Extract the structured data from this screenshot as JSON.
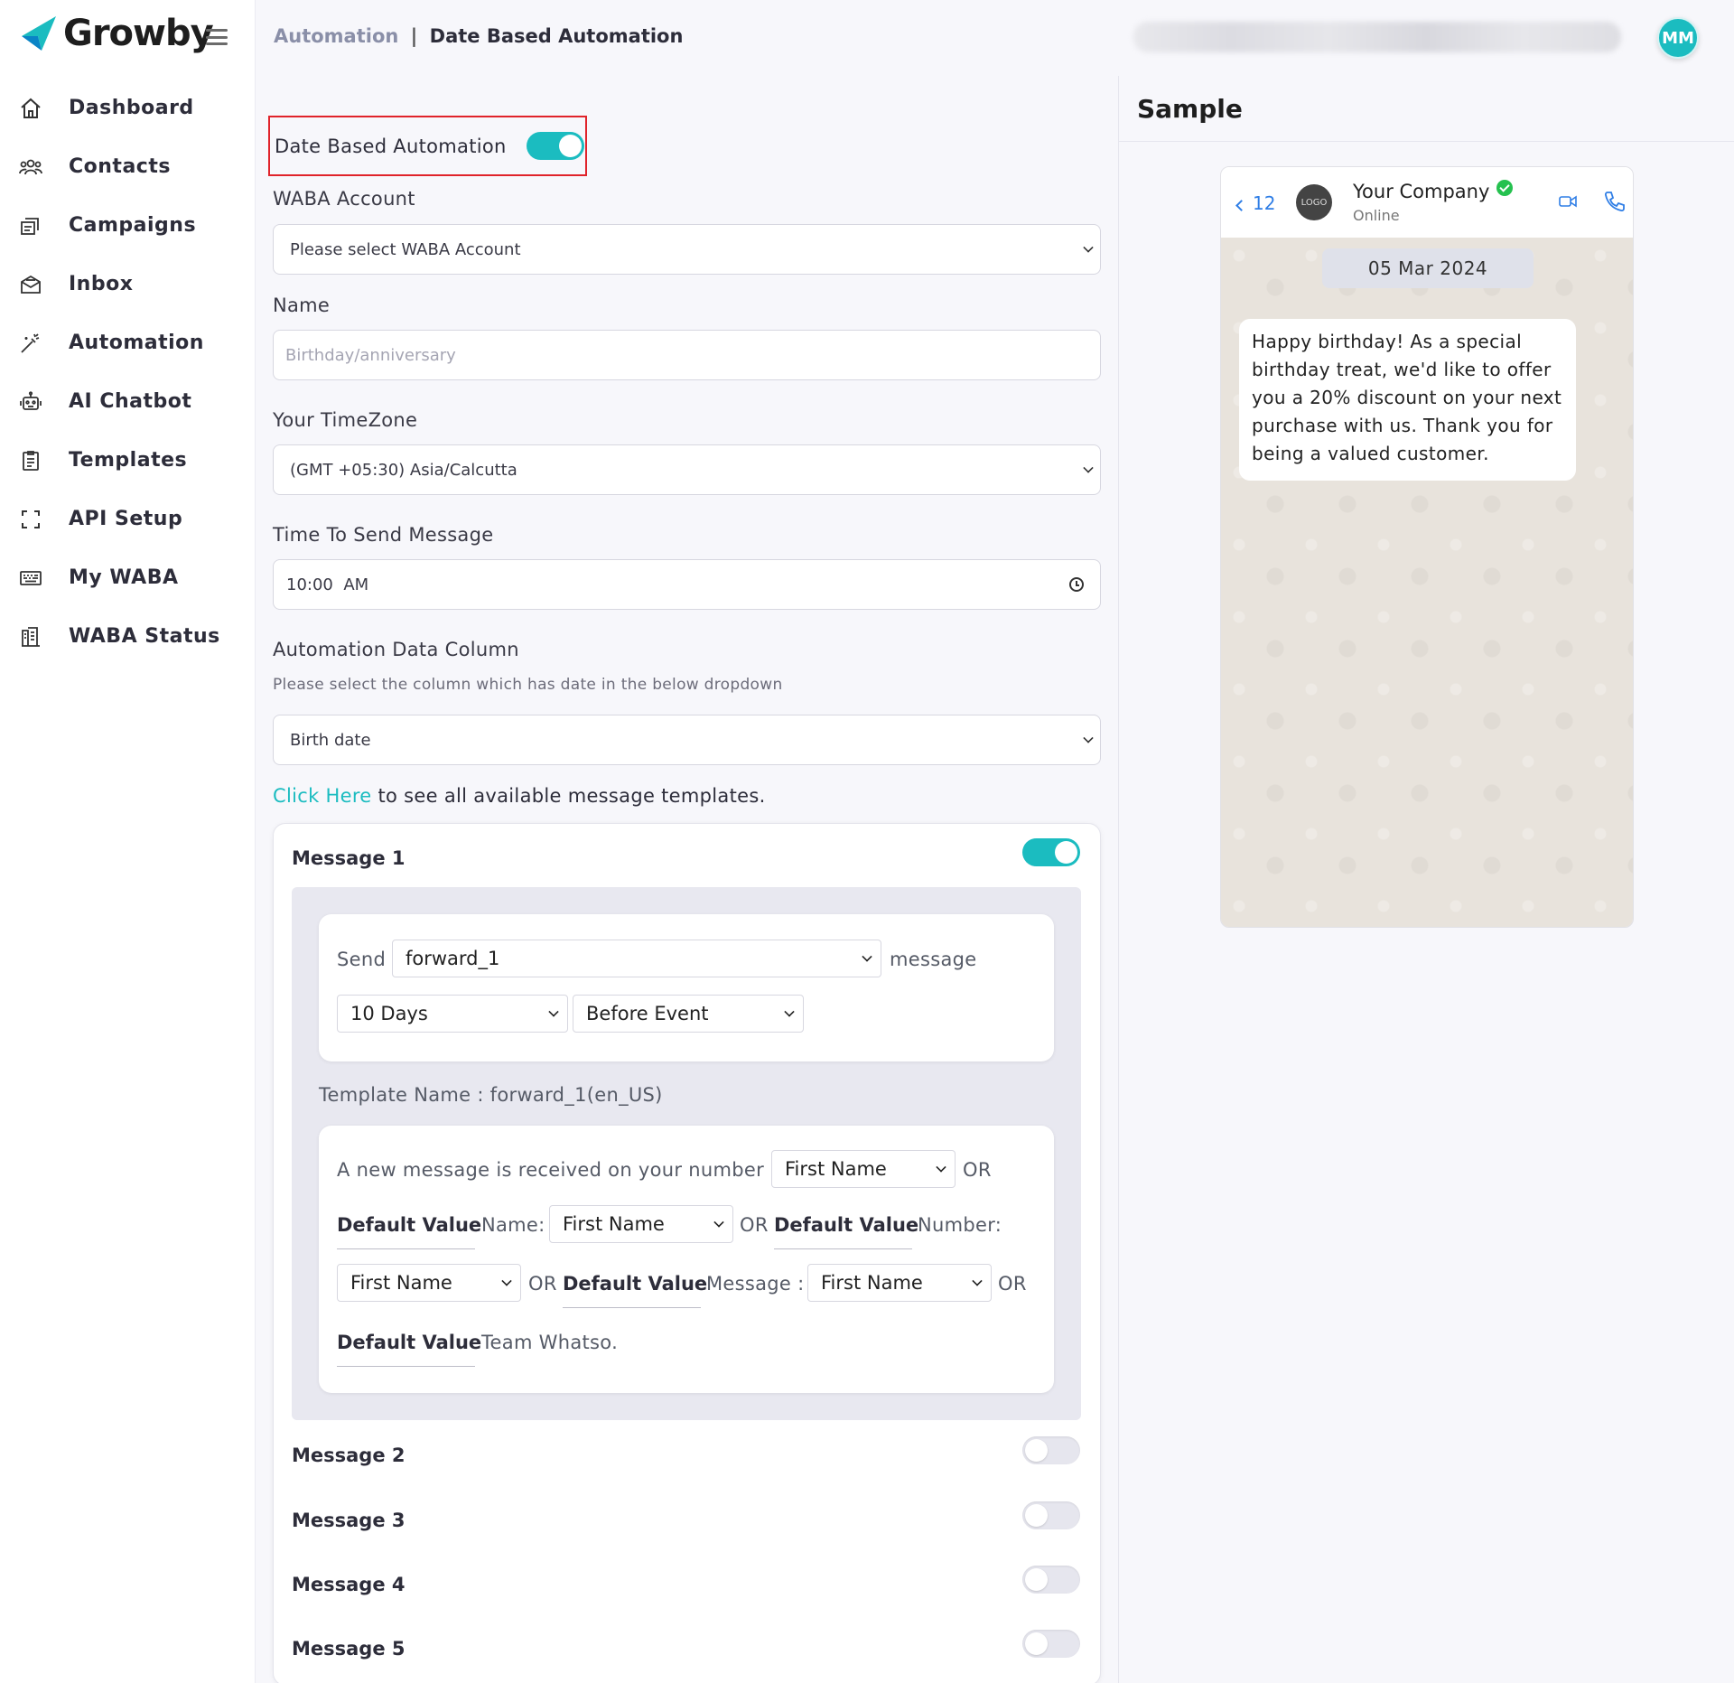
{
  "app": {
    "brand": "Growby",
    "accent_color": "#1bbcc0",
    "highlight_color": "#e0232a"
  },
  "sidebar": {
    "items": [
      {
        "label": "Dashboard",
        "icon": "home-icon"
      },
      {
        "label": "Contacts",
        "icon": "users-icon"
      },
      {
        "label": "Campaigns",
        "icon": "campaign-icon"
      },
      {
        "label": "Inbox",
        "icon": "inbox-icon"
      },
      {
        "label": "Automation",
        "icon": "magic-wand-icon"
      },
      {
        "label": "AI Chatbot",
        "icon": "robot-icon"
      },
      {
        "label": "Templates",
        "icon": "clipboard-icon"
      },
      {
        "label": "API Setup",
        "icon": "frame-icon"
      },
      {
        "label": "My WABA",
        "icon": "keyboard-icon"
      },
      {
        "label": "WABA Status",
        "icon": "building-icon"
      }
    ]
  },
  "header": {
    "breadcrumb_parent": "Automation",
    "breadcrumb_sep": "|",
    "breadcrumb_current": "Date Based Automation",
    "avatar_initials": "MM"
  },
  "form": {
    "toggle_label": "Date Based Automation",
    "toggle_on": true,
    "waba_label": "WABA Account",
    "waba_value": "Please select WABA Account",
    "name_label": "Name",
    "name_placeholder": "Birthday/anniversary",
    "timezone_label": "Your TimeZone",
    "timezone_value": "(GMT +05:30) Asia/Calcutta",
    "time_label": "Time To Send Message",
    "time_value": "10:00  AM",
    "column_label": "Automation Data Column",
    "column_hint": "Please select the column which has date in the below dropdown",
    "column_value": "Birth date",
    "click_here": "Click Here",
    "click_rest": " to see all available message templates."
  },
  "messages": {
    "m1": {
      "title": "Message 1",
      "enabled": true,
      "send_label": "Send",
      "template_select": "forward_1",
      "message_label": "message",
      "days_select": "10 Days",
      "event_select": "Before Event",
      "template_name": "Template Name : forward_1(en_US)",
      "var_line1": "A new message is received on your number",
      "first_name": "First Name",
      "or": "OR",
      "default_value": "Default Value",
      "name_label": "Name:",
      "number_label": "Number:",
      "message_colon": "Message :",
      "team": "Team Whatso."
    },
    "m2": {
      "title": "Message 2",
      "enabled": false
    },
    "m3": {
      "title": "Message 3",
      "enabled": false
    },
    "m4": {
      "title": "Message 4",
      "enabled": false
    },
    "m5": {
      "title": "Message 5",
      "enabled": false
    }
  },
  "sample": {
    "title": "Sample",
    "back_count": "12",
    "logo_text": "LOGO",
    "company": "Your Company",
    "status": "Online",
    "date": "05 Mar 2024",
    "bubble": "Happy birthday! As a special birthday treat, we'd like to offer you a 20% discount on your next purchase with us. Thank you for being a valued customer."
  }
}
